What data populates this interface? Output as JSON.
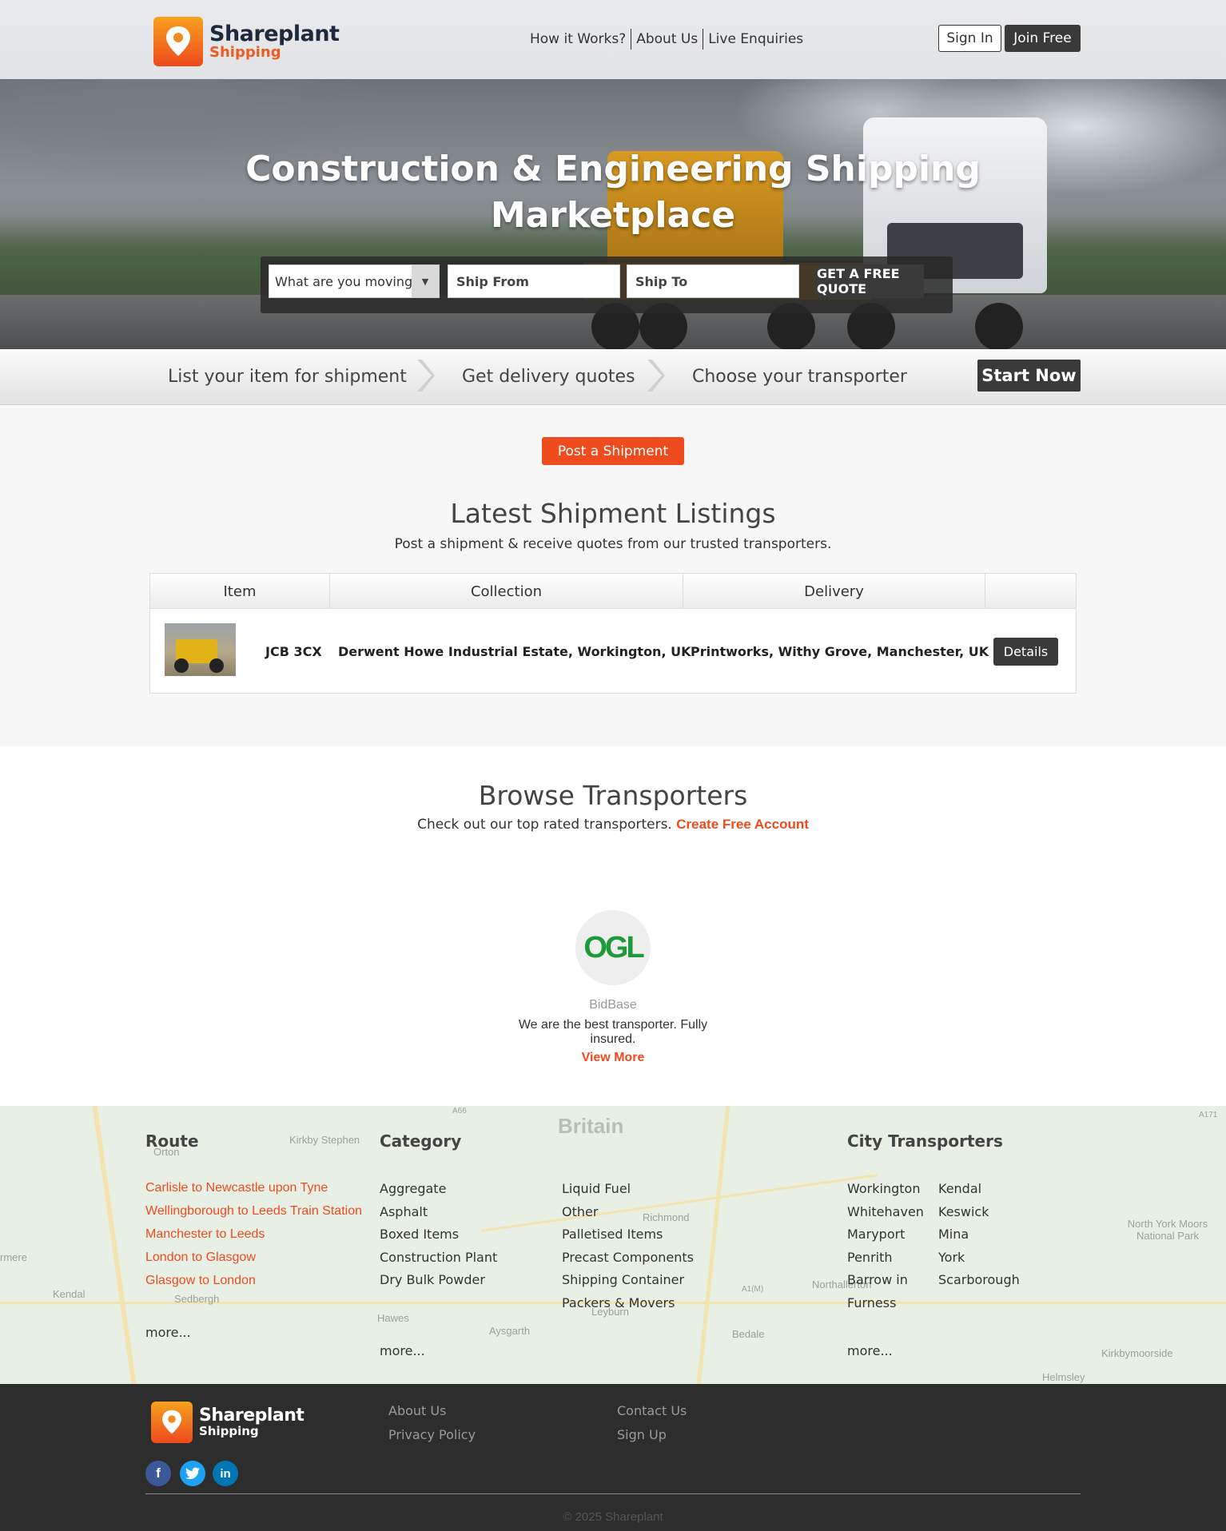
{
  "header": {
    "logo_name": "Shareplant",
    "logo_sub": "Shipping",
    "nav": [
      "How it Works?",
      "About Us",
      "Live Enquiries"
    ],
    "sign_in": "Sign In",
    "join_free": "Join Free"
  },
  "hero": {
    "title_line1": "Construction & Engineering Shipping",
    "title_line2": "Marketplace",
    "select_value": "What are you moving?",
    "ship_from": "Ship From",
    "ship_to": "Ship To",
    "quote_button": "GET A FREE QUOTE"
  },
  "steps": {
    "items": [
      "List your item for shipment",
      "Get delivery quotes",
      "Choose your transporter"
    ],
    "start_button": "Start Now"
  },
  "listings": {
    "post_button": "Post a Shipment",
    "title": "Latest Shipment Listings",
    "subtitle": "Post a shipment & receive quotes from our trusted transporters.",
    "columns": [
      "Item",
      "Collection",
      "Delivery",
      ""
    ],
    "rows": [
      {
        "item": "JCB 3CX",
        "collection": "Derwent Howe Industrial Estate, Workington, UK",
        "delivery": "Printworks, Withy Grove, Manchester, UK",
        "action": "Details"
      }
    ]
  },
  "browse": {
    "title": "Browse Transporters",
    "subtitle": "Check out our top rated transporters.",
    "create_link": "Create Free Account",
    "transporter": {
      "logo_text": "OGL",
      "name": "BidBase",
      "description": "We are the best transporter. Fully insured.",
      "view_more": "View More"
    }
  },
  "map_links": {
    "map_labels": [
      "Britain",
      "Kirkby Stephen",
      "Orton",
      "Kendal",
      "Sedbergh",
      "Hawes",
      "Aysgarth",
      "Leyburn",
      "Richmond",
      "Bedale",
      "Northallerton",
      "North York Moors National Park",
      "Kirkbymoorside",
      "Helmsley",
      "rmere",
      "A1(M)",
      "A66",
      "A171"
    ],
    "route_title": "Route",
    "routes": [
      "Carlisle to Newcastle upon Tyne",
      "Wellingborough to Leeds Train Station",
      "Manchester to Leeds",
      "London to Glasgow",
      "Glasgow to London"
    ],
    "route_more": "more...",
    "category_title": "Category",
    "categories_col1": [
      "Aggregate",
      "Asphalt",
      "Boxed Items",
      "Construction Plant",
      "Dry Bulk Powder"
    ],
    "categories_col2": [
      "Liquid Fuel",
      "Other",
      "Palletised Items",
      "Precast Components",
      "Shipping Container",
      "Packers & Movers"
    ],
    "category_more": "more...",
    "city_title": "City Transporters",
    "cities_col1": [
      "Workington",
      "Whitehaven",
      "Maryport",
      "Penrith",
      "Barrow in",
      "Furness"
    ],
    "cities_col2": [
      "Kendal",
      "Keswick",
      "Mina",
      "York",
      "Scarborough"
    ],
    "city_more": "more..."
  },
  "footer": {
    "logo_name": "Shareplant",
    "logo_sub": "Shipping",
    "links_col1": [
      "About Us",
      "Privacy Policy"
    ],
    "links_col2": [
      "Contact Us",
      "Sign Up"
    ],
    "social": [
      "facebook-icon",
      "twitter-icon",
      "linkedin-icon"
    ],
    "copyright": "© 2025 Shareplant"
  },
  "colors": {
    "accent": "#ee4c1e",
    "dark_button": "#3a3a3a",
    "footer_bg": "#2d2d2d",
    "map_bg": "#e8efe4"
  }
}
